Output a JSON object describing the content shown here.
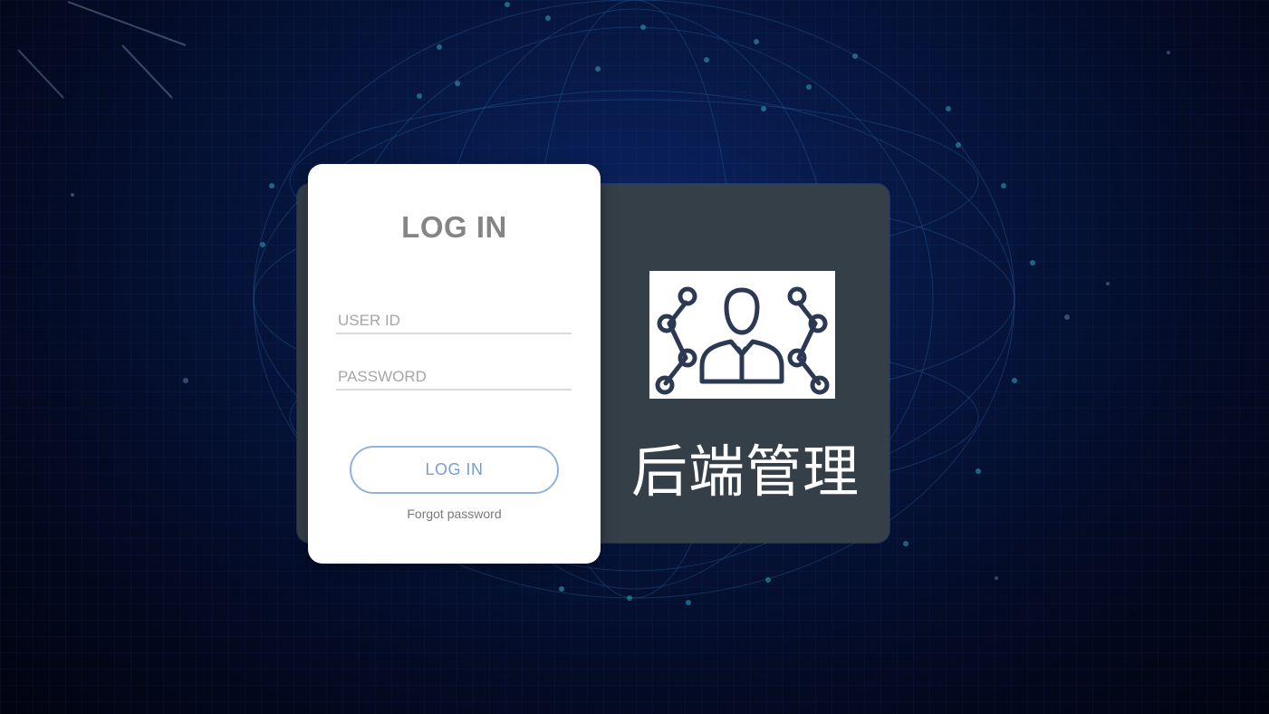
{
  "login": {
    "title": "LOG IN",
    "user_placeholder": "USER ID",
    "password_placeholder": "PASSWORD",
    "button_label": "LOG IN",
    "forgot_label": "Forgot password"
  },
  "brand": {
    "title": "后端管理",
    "logo_icon": "user-network-icon"
  },
  "colors": {
    "background": "#06153d",
    "panel": "#353f48",
    "button_border": "#8fb2de",
    "button_text": "#7a9ed0",
    "logo_stroke": "#2b3a52"
  }
}
